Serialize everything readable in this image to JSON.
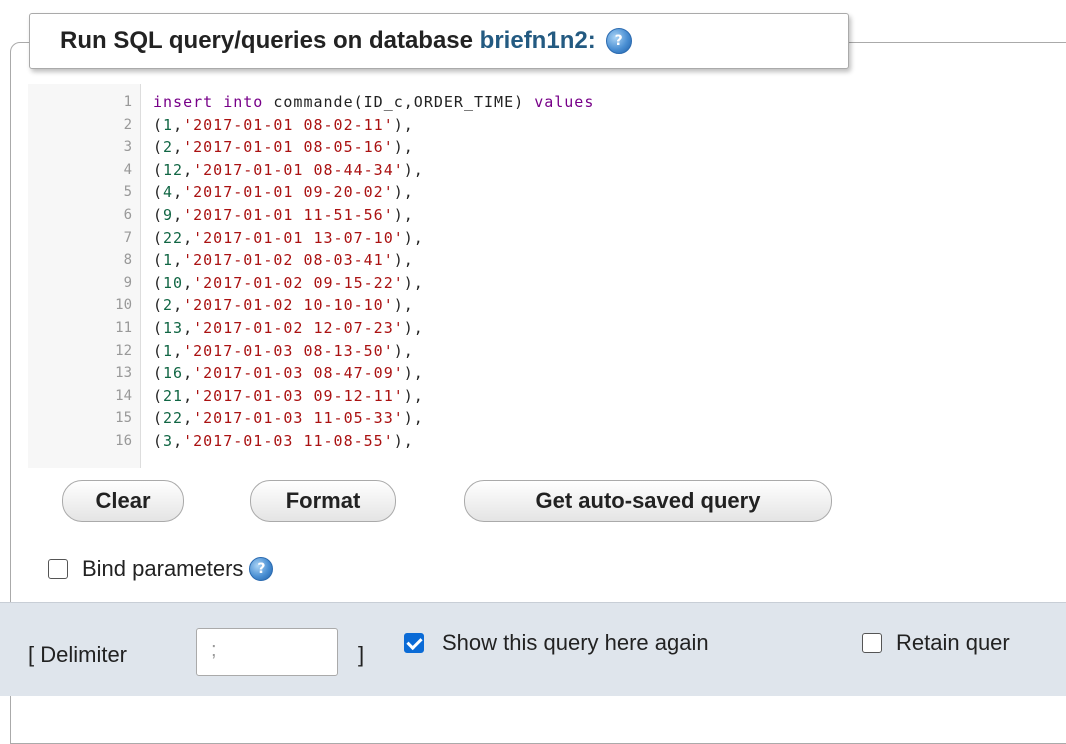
{
  "legend": {
    "title_prefix": "Run SQL query/queries on database ",
    "database": "briefn1n2:"
  },
  "editor": {
    "lines": [
      {
        "n": "1",
        "parts": [
          [
            "kw",
            "insert into "
          ],
          [
            "tb",
            "commande(ID_c,ORDER_TIME) "
          ],
          [
            "kw",
            "values"
          ]
        ]
      },
      {
        "n": "2",
        "parts": [
          [
            "punc",
            "("
          ],
          [
            "num",
            "1"
          ],
          [
            "punc",
            ","
          ],
          [
            "str",
            "'2017-01-01 08-02-11'"
          ],
          [
            "punc",
            "),"
          ]
        ]
      },
      {
        "n": "3",
        "parts": [
          [
            "punc",
            "("
          ],
          [
            "num",
            "2"
          ],
          [
            "punc",
            ","
          ],
          [
            "str",
            "'2017-01-01 08-05-16'"
          ],
          [
            "punc",
            "),"
          ]
        ]
      },
      {
        "n": "4",
        "parts": [
          [
            "punc",
            "("
          ],
          [
            "num",
            "12"
          ],
          [
            "punc",
            ","
          ],
          [
            "str",
            "'2017-01-01 08-44-34'"
          ],
          [
            "punc",
            "),"
          ]
        ]
      },
      {
        "n": "5",
        "parts": [
          [
            "punc",
            "("
          ],
          [
            "num",
            "4"
          ],
          [
            "punc",
            ","
          ],
          [
            "str",
            "'2017-01-01 09-20-02'"
          ],
          [
            "punc",
            "),"
          ]
        ]
      },
      {
        "n": "6",
        "parts": [
          [
            "punc",
            "("
          ],
          [
            "num",
            "9"
          ],
          [
            "punc",
            ","
          ],
          [
            "str",
            "'2017-01-01 11-51-56'"
          ],
          [
            "punc",
            "),"
          ]
        ]
      },
      {
        "n": "7",
        "parts": [
          [
            "punc",
            "("
          ],
          [
            "num",
            "22"
          ],
          [
            "punc",
            ","
          ],
          [
            "str",
            "'2017-01-01 13-07-10'"
          ],
          [
            "punc",
            "),"
          ]
        ]
      },
      {
        "n": "8",
        "parts": [
          [
            "punc",
            "("
          ],
          [
            "num",
            "1"
          ],
          [
            "punc",
            ","
          ],
          [
            "str",
            "'2017-01-02 08-03-41'"
          ],
          [
            "punc",
            "),"
          ]
        ]
      },
      {
        "n": "9",
        "parts": [
          [
            "punc",
            "("
          ],
          [
            "num",
            "10"
          ],
          [
            "punc",
            ","
          ],
          [
            "str",
            "'2017-01-02 09-15-22'"
          ],
          [
            "punc",
            "),"
          ]
        ]
      },
      {
        "n": "10",
        "parts": [
          [
            "punc",
            "("
          ],
          [
            "num",
            "2"
          ],
          [
            "punc",
            ","
          ],
          [
            "str",
            "'2017-01-02 10-10-10'"
          ],
          [
            "punc",
            "),"
          ]
        ]
      },
      {
        "n": "11",
        "parts": [
          [
            "punc",
            "("
          ],
          [
            "num",
            "13"
          ],
          [
            "punc",
            ","
          ],
          [
            "str",
            "'2017-01-02 12-07-23'"
          ],
          [
            "punc",
            "),"
          ]
        ]
      },
      {
        "n": "12",
        "parts": [
          [
            "punc",
            "("
          ],
          [
            "num",
            "1"
          ],
          [
            "punc",
            ","
          ],
          [
            "str",
            "'2017-01-03 08-13-50'"
          ],
          [
            "punc",
            "),"
          ]
        ]
      },
      {
        "n": "13",
        "parts": [
          [
            "punc",
            "("
          ],
          [
            "num",
            "16"
          ],
          [
            "punc",
            ","
          ],
          [
            "str",
            "'2017-01-03 08-47-09'"
          ],
          [
            "punc",
            "),"
          ]
        ]
      },
      {
        "n": "14",
        "parts": [
          [
            "punc",
            "("
          ],
          [
            "num",
            "21"
          ],
          [
            "punc",
            ","
          ],
          [
            "str",
            "'2017-01-03 09-12-11'"
          ],
          [
            "punc",
            "),"
          ]
        ]
      },
      {
        "n": "15",
        "parts": [
          [
            "punc",
            "("
          ],
          [
            "num",
            "22"
          ],
          [
            "punc",
            ","
          ],
          [
            "str",
            "'2017-01-03 11-05-33'"
          ],
          [
            "punc",
            "),"
          ]
        ]
      },
      {
        "n": "16",
        "parts": [
          [
            "punc",
            "("
          ],
          [
            "num",
            "3"
          ],
          [
            "punc",
            ","
          ],
          [
            "str",
            "'2017-01-03 11-08-55'"
          ],
          [
            "punc",
            "),"
          ]
        ]
      }
    ]
  },
  "buttons": {
    "clear": "Clear",
    "format": "Format",
    "autosaved": "Get auto-saved query"
  },
  "bind_parameters": {
    "label": "Bind parameters",
    "checked": false
  },
  "footer": {
    "delimiter_open": "[ Delimiter",
    "delimiter_value": ";",
    "delimiter_close": "]",
    "show_again": {
      "label": "Show this query here again",
      "checked": true
    },
    "retain": {
      "label": "Retain quer",
      "checked": false
    }
  },
  "colors": {
    "keyword": "#770088",
    "number": "#116644",
    "string": "#aa1111",
    "database_link": "#235a81",
    "checkbox_accent": "#0b6bd6"
  }
}
